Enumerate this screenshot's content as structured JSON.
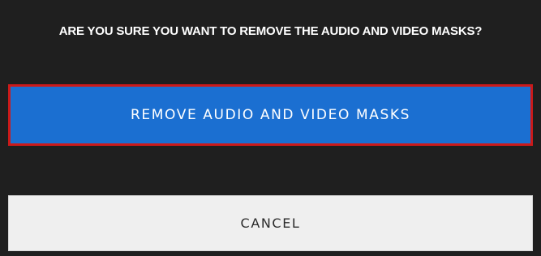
{
  "dialog": {
    "title": "ARE YOU SURE YOU WANT TO REMOVE THE AUDIO AND VIDEO MASKS?",
    "confirm_label": "REMOVE AUDIO AND VIDEO MASKS",
    "cancel_label": "CANCEL"
  },
  "colors": {
    "background": "#1f1f1f",
    "confirm_button": "#1b6fd1",
    "confirm_focus_border": "#cc1a1a",
    "cancel_button": "#efefef"
  }
}
